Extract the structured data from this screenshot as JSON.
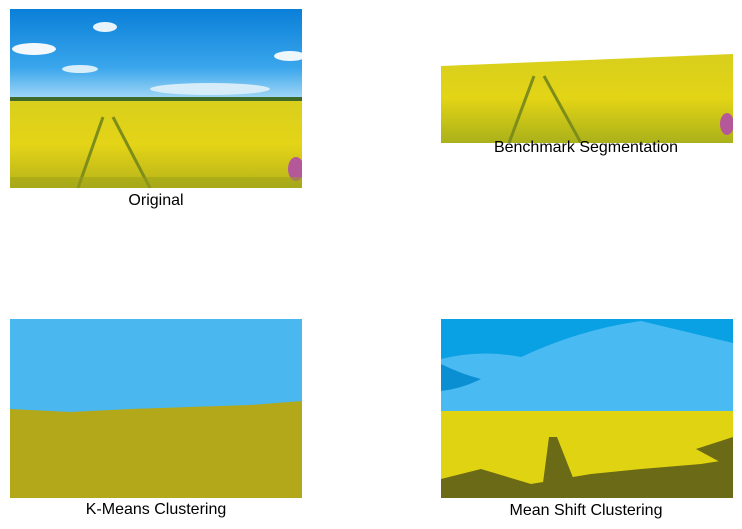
{
  "panels": [
    {
      "id": "original",
      "caption": "Original"
    },
    {
      "id": "benchmark",
      "caption": "Benchmark Segmentation"
    },
    {
      "id": "kmeans",
      "caption": "K-Means Clustering"
    },
    {
      "id": "meanshift",
      "caption": "Mean Shift Clustering"
    }
  ],
  "colors": {
    "sky_deep": "#0d8fe0",
    "sky_light": "#6cc4f2",
    "field_yellow": "#e2d20e",
    "field_dark": "#8a8a12",
    "flower_pink": "#b5589a",
    "kmeans_sky": "#4ab8ee",
    "kmeans_field": "#b3a71a",
    "meanshift_sky_dark": "#09a0e4",
    "meanshift_sky_light": "#49bbf2",
    "meanshift_field": "#e0d412",
    "meanshift_field_dark": "#6b6a16"
  }
}
